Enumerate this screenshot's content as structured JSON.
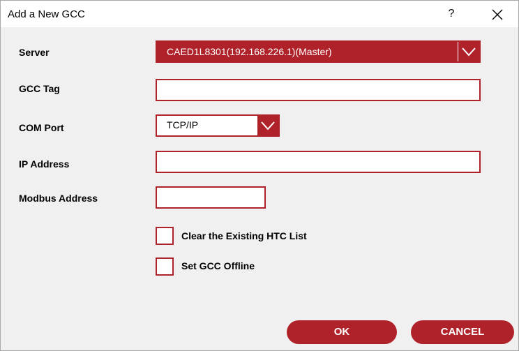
{
  "window": {
    "title": "Add a New GCC",
    "help_label": "?"
  },
  "form": {
    "server_label": "Server",
    "server_value": "CAED1L8301(192.168.226.1)(Master)",
    "gcc_tag_label": "GCC Tag",
    "gcc_tag_value": "",
    "com_port_label": "COM Port",
    "com_port_value": "TCP/IP",
    "ip_address_label": "IP Address",
    "ip_address_value": "",
    "modbus_address_label": "Modbus Address",
    "modbus_address_value": ""
  },
  "options": {
    "clear_htc_label": "Clear the Existing HTC List",
    "clear_htc_checked": false,
    "offline_label": "Set GCC Offline",
    "offline_checked": false
  },
  "buttons": {
    "ok_label": "OK",
    "cancel_label": "CANCEL"
  },
  "colors": {
    "accent": "#b0222a",
    "field_background": "#ffffff",
    "dialog_background": "#f0f0f0"
  },
  "icons": {
    "close": "close-icon",
    "dropdown": "chevron-down-icon"
  }
}
